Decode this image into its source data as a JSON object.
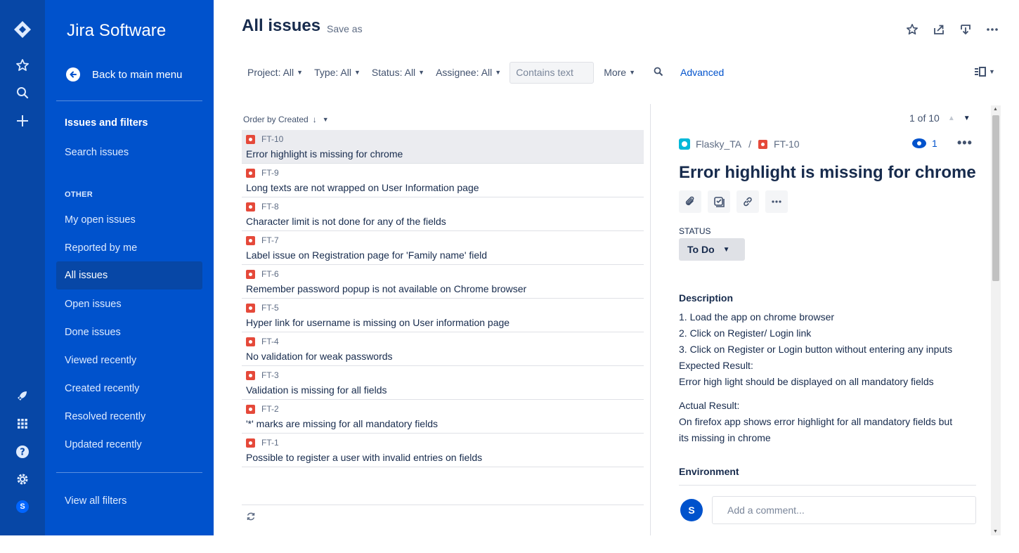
{
  "global_nav": {
    "icons": [
      "jira-logo-icon",
      "star-icon",
      "search-icon",
      "plus-icon",
      "rocket-icon",
      "apps-grid-icon",
      "help-icon",
      "settings-icon"
    ],
    "avatar_initial": "S"
  },
  "sidebar": {
    "brand": "Jira Software",
    "back": "Back to main menu",
    "items_top": [
      {
        "label": "Issues and filters"
      },
      {
        "label": "Search issues"
      }
    ],
    "section_label": "OTHER",
    "items": [
      {
        "label": "My open issues"
      },
      {
        "label": "Reported by me"
      },
      {
        "label": "All issues"
      },
      {
        "label": "Open issues"
      },
      {
        "label": "Done issues"
      },
      {
        "label": "Viewed recently"
      },
      {
        "label": "Created recently"
      },
      {
        "label": "Resolved recently"
      },
      {
        "label": "Updated recently"
      }
    ],
    "view_all": "View all filters"
  },
  "header": {
    "title": "All issues",
    "save_as": "Save as"
  },
  "filters": {
    "project": "Project: All",
    "type": "Type: All",
    "status": "Status: All",
    "assignee": "Assignee: All",
    "search_placeholder": "Contains text",
    "more": "More",
    "advanced": "Advanced"
  },
  "list": {
    "order_by": "Order by Created",
    "issues": [
      {
        "key": "FT-10",
        "summary": "Error highlight is missing for chrome"
      },
      {
        "key": "FT-9",
        "summary": "Long texts are not wrapped on User Information page"
      },
      {
        "key": "FT-8",
        "summary": "Character limit is not done for any of the fields"
      },
      {
        "key": "FT-7",
        "summary": "Label issue on Registration page for 'Family name' field"
      },
      {
        "key": "FT-6",
        "summary": "Remember password popup is not available on Chrome browser"
      },
      {
        "key": "FT-5",
        "summary": "Hyper link for username is missing on User information page"
      },
      {
        "key": "FT-4",
        "summary": "No validation for weak passwords"
      },
      {
        "key": "FT-3",
        "summary": "Validation is missing for all fields"
      },
      {
        "key": "FT-2",
        "summary": "'*' marks are missing for all mandatory fields"
      },
      {
        "key": "FT-1",
        "summary": "Possible to register a user with invalid entries on fields"
      }
    ]
  },
  "detail": {
    "pager": "1 of 10",
    "project": "Flasky_TA",
    "key": "FT-10",
    "watchers": "1",
    "title": "Error highlight is missing for chrome",
    "status_label": "STATUS",
    "status": "To Do",
    "description_heading": "Description",
    "description": {
      "line1": "1. Load the app on chrome browser",
      "line2": "2. Click on Register/ Login link",
      "line3": "3. Click on Register or Login button without entering any inputs",
      "line4": "Expected Result:",
      "line5": "Error high light should be displayed on all mandatory fields",
      "line6": "Actual Result:",
      "line7": "On firefox app shows error highlight for all mandatory fields but",
      "line8": "its missing in chrome"
    },
    "environment_heading": "Environment",
    "comment_avatar": "S",
    "comment_placeholder": "Add a comment..."
  },
  "colors": {
    "global_nav": "#0747A6",
    "sidebar": "#0052CC",
    "accent": "#0052CC",
    "bug": "#E5493A"
  }
}
